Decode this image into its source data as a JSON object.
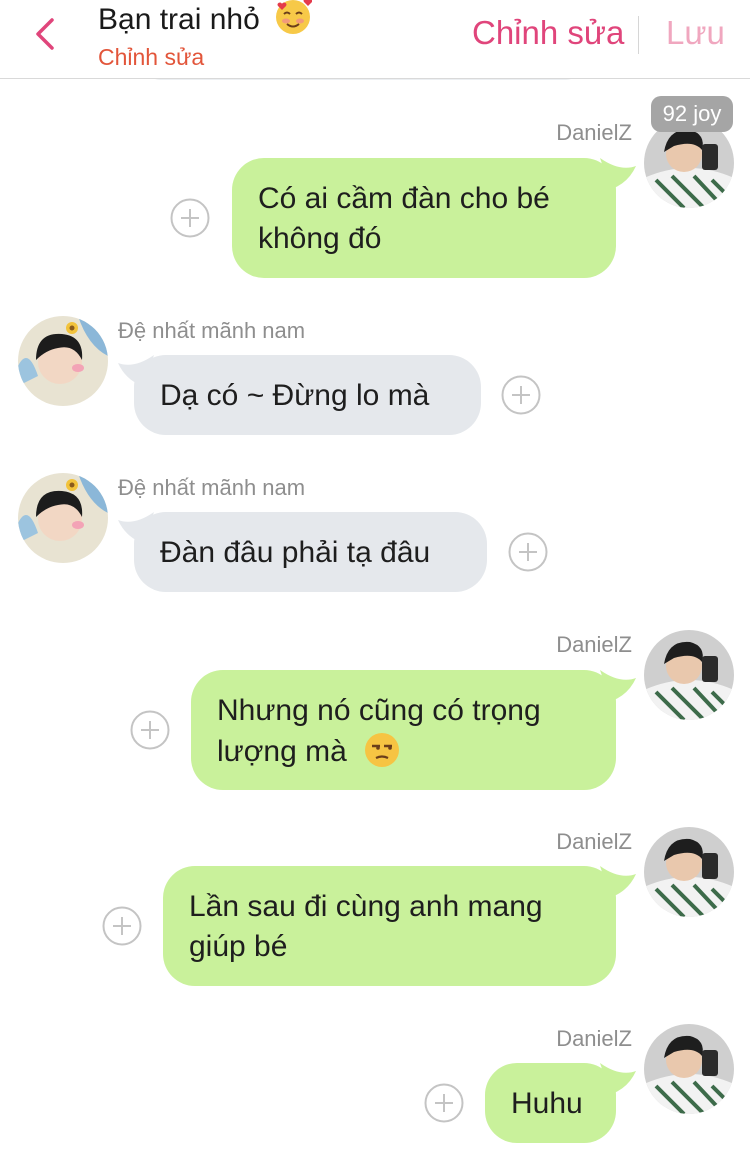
{
  "header": {
    "title": "Bạn trai nhỏ",
    "subtitle": "Chỉnh sửa",
    "edit_label": "Chỉnh sửa",
    "save_label": "Lưu",
    "accent_color": "#e0457b"
  },
  "badge": "92 joy",
  "messages": [
    {
      "side": "out",
      "sender": "DanielZ",
      "text_lines": [
        "Có ai cầm đàn cho bé",
        "không đó"
      ]
    },
    {
      "side": "in",
      "sender": "Đệ nhất mãnh nam",
      "text_lines": [
        "Dạ có ~ Đừng lo mà"
      ]
    },
    {
      "side": "in",
      "sender": "Đệ nhất mãnh nam",
      "text_lines": [
        "Đàn đâu phải tạ đâu"
      ]
    },
    {
      "side": "out",
      "sender": "DanielZ",
      "text_lines": [
        "Nhưng nó cũng có trọng",
        "lượng mà"
      ],
      "emoji": "unamused-face-emoji"
    },
    {
      "side": "out",
      "sender": "DanielZ",
      "text_lines": [
        "Lần sau đi cùng anh mang",
        "giúp bé"
      ]
    },
    {
      "side": "out",
      "sender": "DanielZ",
      "text_lines": [
        "Huhu"
      ]
    }
  ],
  "colors": {
    "outgoing_bubble": "#c9f19b",
    "incoming_bubble": "#e5e8ec",
    "sender_name": "#8e8e8e",
    "subtitle": "#e2553a",
    "save_disabled": "#f0a7bf"
  }
}
